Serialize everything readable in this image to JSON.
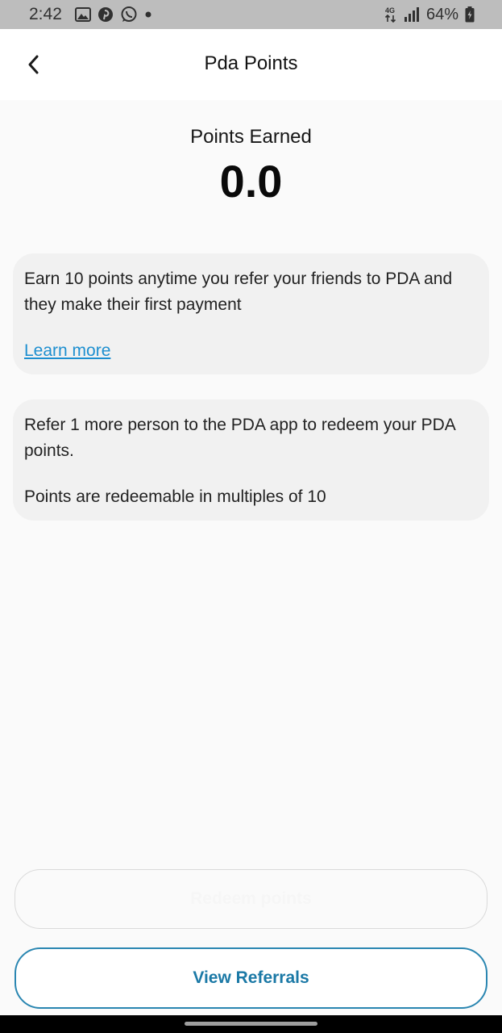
{
  "status_bar": {
    "time": "2:42",
    "notification_icons": [
      "gallery-icon",
      "pinterest-icon",
      "whatsapp-icon",
      "dot-icon"
    ],
    "network_label": "4G",
    "battery": "64%"
  },
  "header": {
    "title": "Pda Points",
    "back_icon": "chevron-left-icon"
  },
  "points": {
    "label": "Points Earned",
    "value": "0.0"
  },
  "info_cards": [
    {
      "text": "Earn 10 points anytime you refer your friends to PDA and they make their first payment",
      "link": "Learn more"
    },
    {
      "text": "Refer 1 more person to the PDA app to redeem your PDA points.",
      "subtext": "Points are redeemable in multiples of 10"
    }
  ],
  "buttons": {
    "redeem": "Redeem points",
    "view_referrals": "View Referrals"
  },
  "colors": {
    "accent": "#1b79a6",
    "link": "#1d8fd0",
    "card_bg": "#f1f1f1",
    "page_bg": "#fafafa"
  }
}
